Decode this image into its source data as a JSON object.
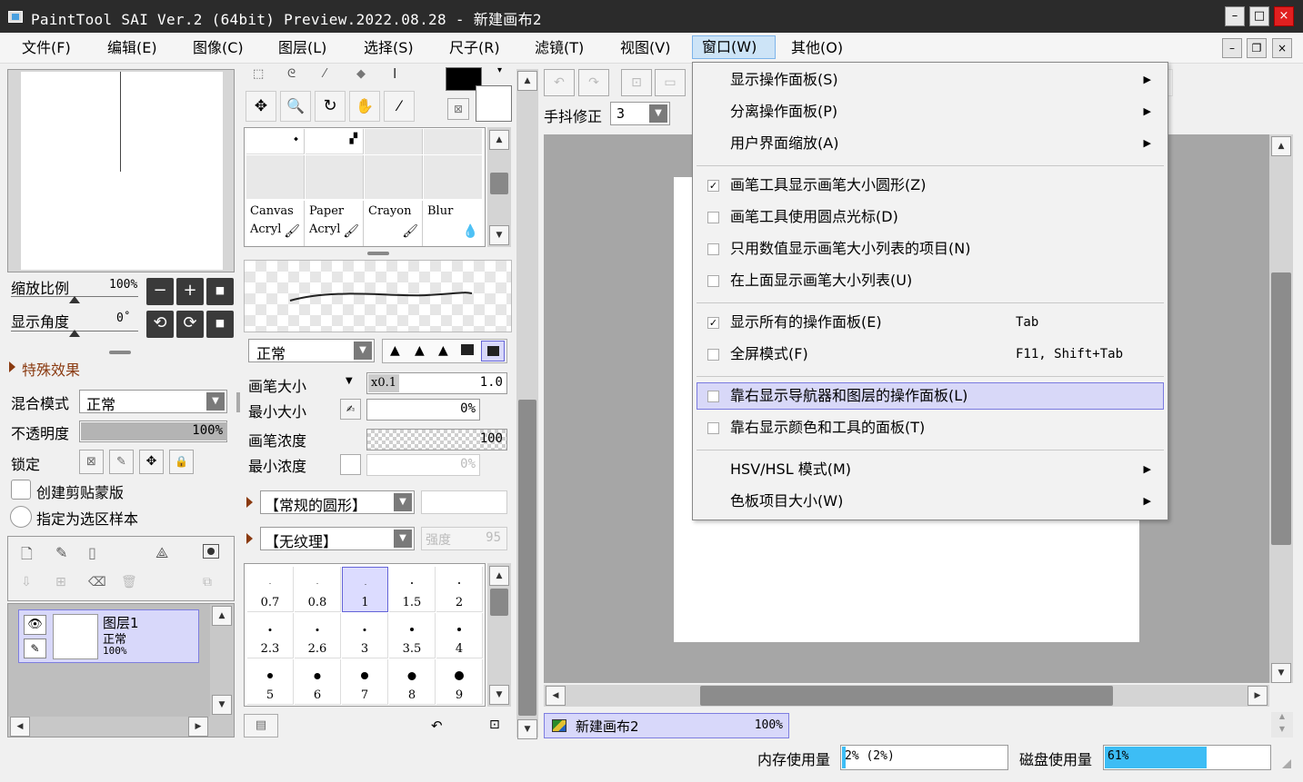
{
  "window": {
    "title": "PaintTool SAI Ver.2 (64bit) Preview.2022.08.28 - 新建画布2",
    "minimize": "–",
    "maximize": "□",
    "close": "×"
  },
  "menubar": {
    "items": [
      "文件(F)",
      "编辑(E)",
      "图像(C)",
      "图层(L)",
      "选择(S)",
      "尺子(R)",
      "滤镜(T)",
      "视图(V)",
      "窗口(W)",
      "其他(O)"
    ],
    "active_index": 8
  },
  "navigator": {
    "zoom_label": "缩放比例",
    "zoom_value": "100%",
    "angle_label": "显示角度",
    "angle_value": "0˚",
    "zoom_out": "−",
    "zoom_in": "+",
    "zoom_reset": "■",
    "rotate_left": "⟲",
    "rotate_right": "⟳",
    "rotate_reset": "■"
  },
  "layer_panel": {
    "special_effects": "特殊效果",
    "blend_label": "混合模式",
    "blend_value": "正常",
    "opacity_label": "不透明度",
    "opacity_value": "100%",
    "opacity_fraction": 1.0,
    "lock_label": "锁定",
    "clipping_label": "创建剪贴蒙版",
    "selection_sample_label": "指定为选区样本",
    "layers": [
      {
        "name": "图层1",
        "mode": "正常",
        "opacity": "100%"
      }
    ]
  },
  "tool_panel": {
    "brushes": [
      {
        "line1": "Canvas",
        "line2": "Acryl"
      },
      {
        "line1": "Paper",
        "line2": "Acryl"
      },
      {
        "line1": "Crayon",
        "line2": ""
      },
      {
        "line1": "Blur",
        "line2": ""
      }
    ],
    "mode_value": "正常",
    "brush_size_label": "画笔大小",
    "brush_size_mult": "x0.1",
    "brush_size_value": "1.0",
    "min_size_label": "最小大小",
    "min_size_value": "0%",
    "density_label": "画笔浓度",
    "density_value": "100",
    "min_density_label": "最小浓度",
    "min_density_value": "0%",
    "shape_value": "【常规的圆形】",
    "texture_value": "【无纹理】",
    "strength_label": "强度",
    "strength_value": "95",
    "sizes": [
      "0.7",
      "0.8",
      "1",
      "1.5",
      "2",
      "2.3",
      "2.6",
      "3",
      "3.5",
      "4",
      "5",
      "6",
      "7",
      "8",
      "9"
    ],
    "selected_size": "1"
  },
  "canvas_toolbar": {
    "stabilizer_label": "手抖修正",
    "stabilizer_value": "3"
  },
  "document_tab": {
    "name": "新建画布2",
    "zoom": "100%"
  },
  "status": {
    "memory_label": "内存使用量",
    "memory_value": "2% (2%)",
    "memory_fraction": 0.02,
    "disk_label": "磁盘使用量",
    "disk_value": "61%",
    "disk_fraction": 0.61,
    "disk_color": "#3dbdf5"
  },
  "window_menu": {
    "items": [
      {
        "label": "显示操作面板(S)",
        "submenu": true
      },
      {
        "label": "分离操作面板(P)",
        "submenu": true
      },
      {
        "label": "用户界面缩放(A)",
        "submenu": true
      },
      {
        "label": "画笔工具显示画笔大小圆形(Z)",
        "checked": true
      },
      {
        "label": "画笔工具使用圆点光标(D)",
        "checked": false
      },
      {
        "label": "只用数值显示画笔大小列表的项目(N)",
        "checked": false
      },
      {
        "label": "在上面显示画笔大小列表(U)",
        "checked": false
      },
      {
        "label": "显示所有的操作面板(E)",
        "checked": true,
        "shortcut": "Tab"
      },
      {
        "label": "全屏模式(F)",
        "checked": false,
        "shortcut": "F11, Shift+Tab"
      },
      {
        "label": "靠右显示导航器和图层的操作面板(L)",
        "checked": false,
        "highlighted": true
      },
      {
        "label": "靠右显示颜色和工具的面板(T)",
        "checked": false
      },
      {
        "label": "HSV/HSL 模式(M)",
        "submenu": true
      },
      {
        "label": "色板项目大小(W)",
        "submenu": true
      }
    ]
  }
}
